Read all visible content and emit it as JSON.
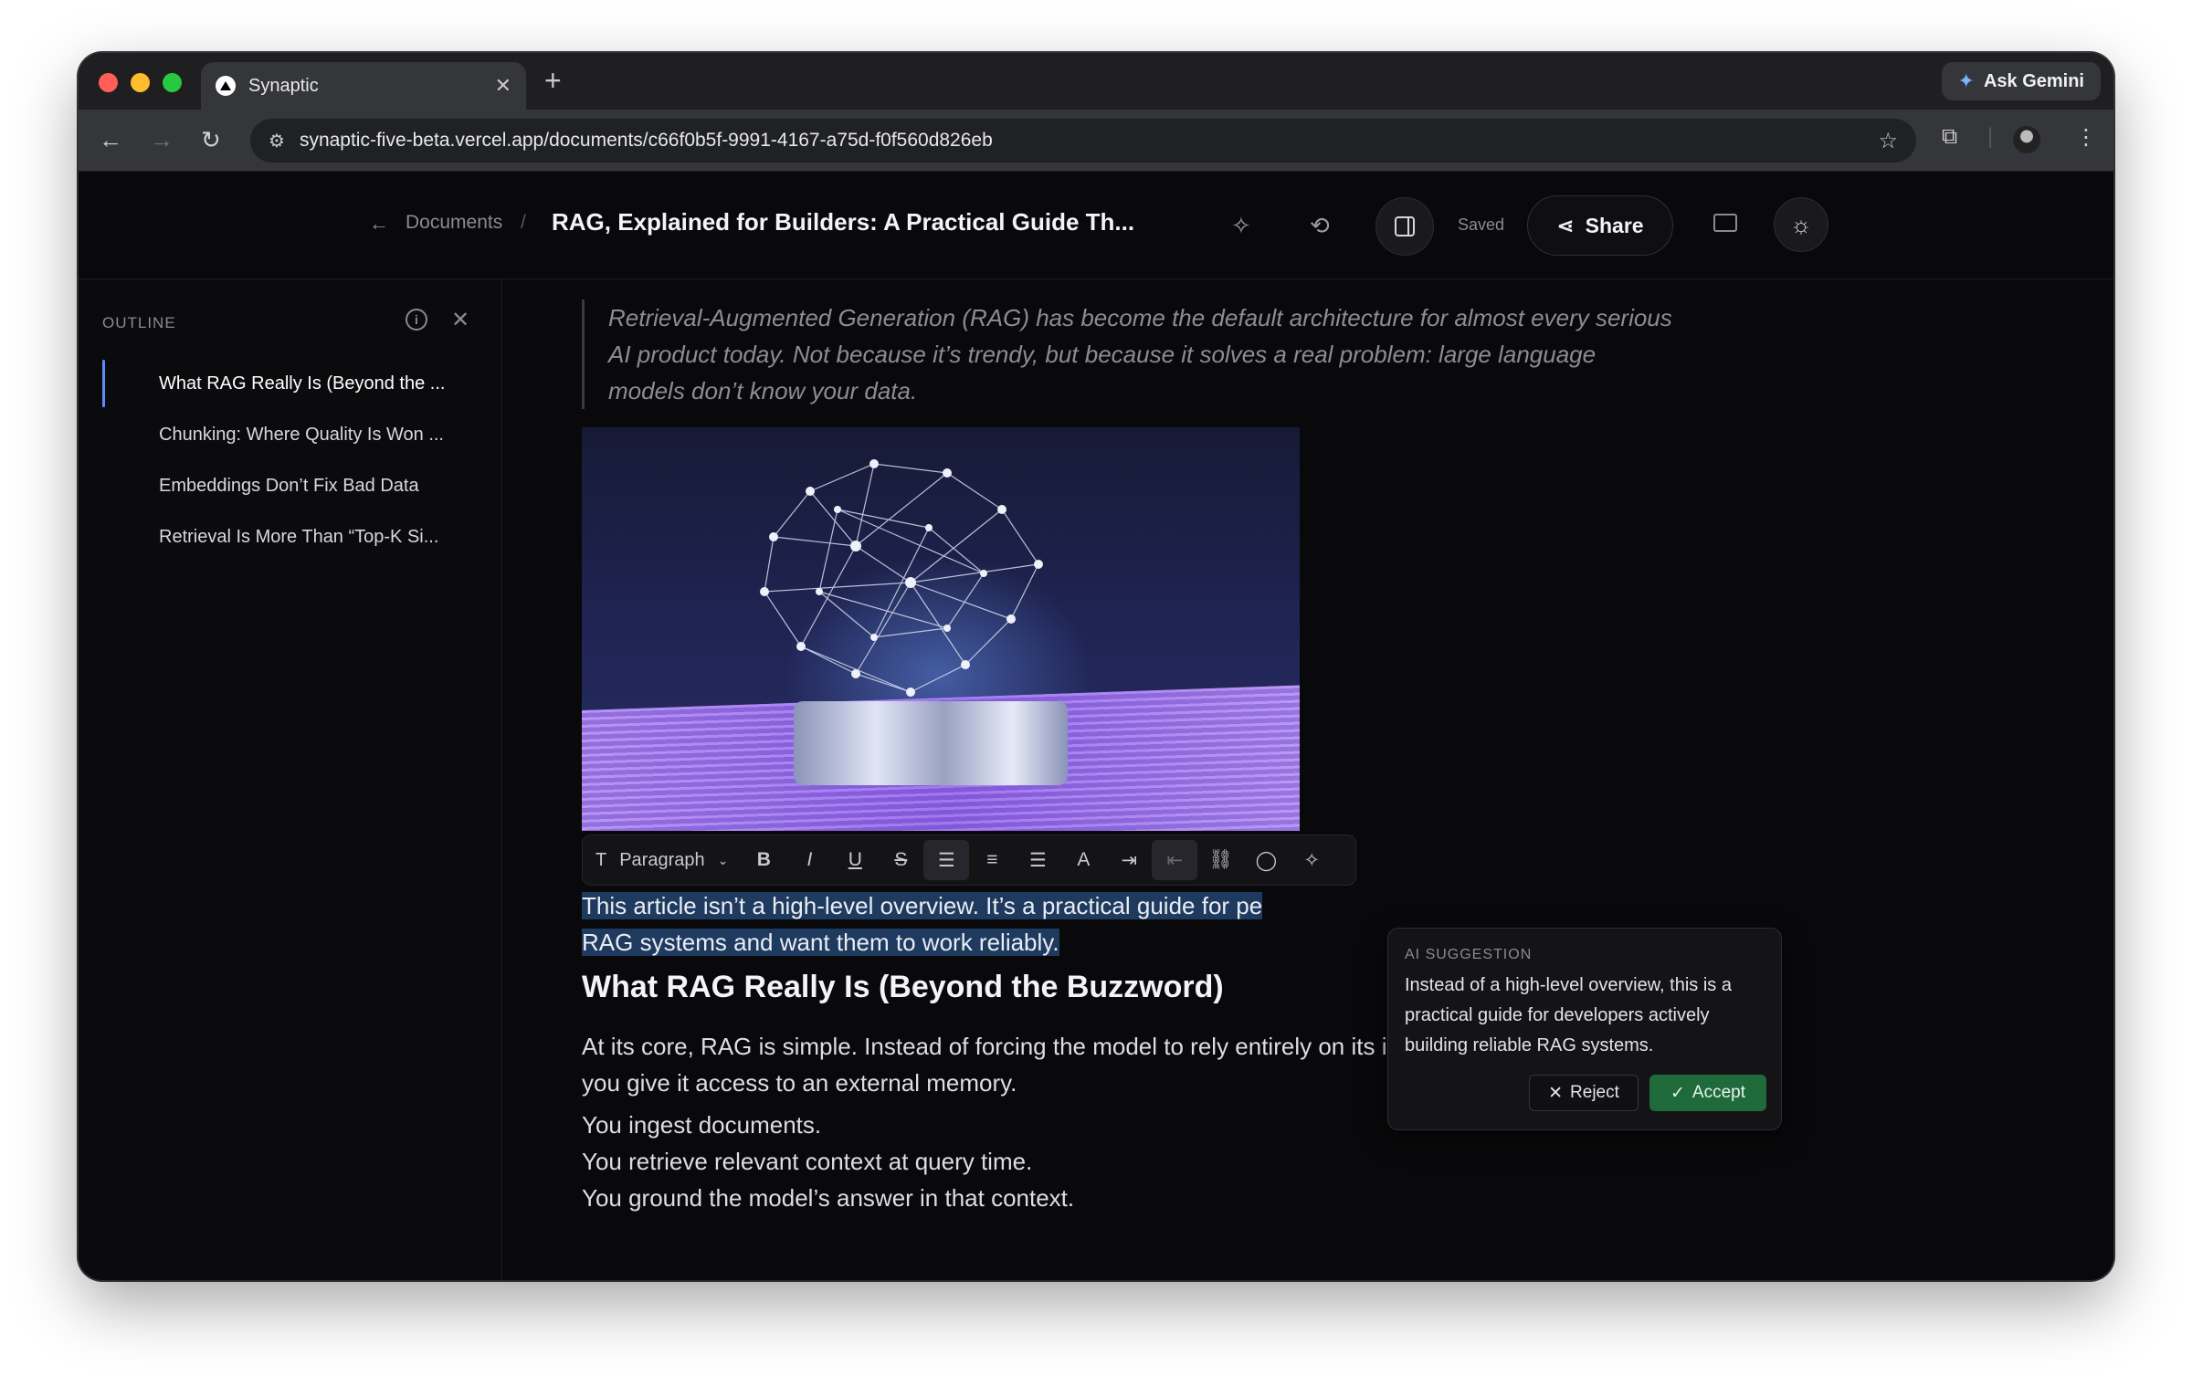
{
  "browser": {
    "tab_title": "Synaptic",
    "tab_close": "✕",
    "new_tab": "+",
    "gemini_label": "Ask Gemini",
    "url": "synaptic-five-beta.vercel.app/documents/c66f0b5f-9991-4167-a75d-f0f560d826eb"
  },
  "header": {
    "breadcrumb_root": "Documents",
    "breadcrumb_sep": "/",
    "title": "RAG, Explained for Builders: A Practical Guide Th...",
    "saved_label": "Saved",
    "share_label": "Share"
  },
  "outline": {
    "title": "OUTLINE",
    "info": "i",
    "close": "✕",
    "items": [
      {
        "label": "What RAG Really Is (Beyond the ..."
      },
      {
        "label": "Chunking: Where Quality Is Won ..."
      },
      {
        "label": "Embeddings Don’t Fix Bad Data"
      },
      {
        "label": "Retrieval Is More Than “Top-K Si..."
      }
    ]
  },
  "editor": {
    "quote": "Retrieval-Augmented Generation (RAG) has become the default architecture for almost every serious AI product today. Not because it’s trendy, but because it solves a real problem: large language models don’t know your data.",
    "toolbar": {
      "paragraph_label": "Paragraph"
    },
    "selected_line1": "This article isn’t a high-level overview. It’s a practical guide for pe",
    "selected_line2": "RAG systems and want them to work reliably.",
    "heading": "What RAG Really Is (Beyond the Buzzword)",
    "para1_line1": "At its core, RAG is simple. Instead of forcing the model to rely entirely on its internal knowledge,",
    "para1_line2": "you give it access to an external memory.",
    "list_line1": "You ingest documents.",
    "list_line2": "You retrieve relevant context at query time.",
    "list_line3": "You ground the model’s answer in that context."
  },
  "ai_suggestion": {
    "label": "AI SUGGESTION",
    "text": "Instead of a high-level overview, this is a practical guide for developers actively building reliable RAG systems.",
    "reject_label": "Reject",
    "accept_label": "Accept"
  },
  "colors": {
    "accent": "#5b8cff",
    "accept_green": "#1e6a3a",
    "selection": "#1f3a5f"
  }
}
